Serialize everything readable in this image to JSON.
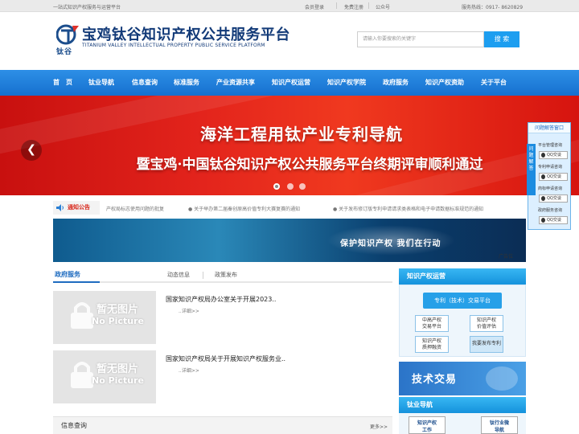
{
  "topbar": {
    "slogan": "一站式知识产权服务与运营平台",
    "login": "会员登录",
    "register": "免费注册",
    "wechat": "公众号",
    "hotline": "服务热线：0917- 8620829"
  },
  "header": {
    "logo_mark": "钛谷",
    "title": "宝鸡钛谷知识产权公共服务平台",
    "subtitle": "TITANIUM VALLEY INTELLECTUAL PROPERTY PUBLIC SERVICE PLATFORM",
    "search_placeholder": "请输入你要搜索的关键字",
    "search_button": "搜 索"
  },
  "nav": [
    "首　页",
    "钛业导航",
    "信息查询",
    "标准服务",
    "产业资源共享",
    "知识产权运营",
    "知识产权学院",
    "政府服务",
    "知识产权资助",
    "关于平台"
  ],
  "banner": {
    "line1": "海洋工程用钛产业专利导航",
    "line2": "暨宝鸡·中国钛谷知识产权公共服务平台终期评审顺利通过",
    "slide_total": 3,
    "slide_active": 1
  },
  "notice": {
    "label": "通知公告",
    "items": [
      "产权局标志使用问题的批复",
      "● 关于举办第二届秦创原高价值专利大赛复赛的通知",
      "● 关于发布修订版专利申请请求类表格和电子申请数据标准规范的通知"
    ]
  },
  "ad": {
    "text": "保护知识产权   我们在行动",
    "tag": "广告位"
  },
  "tabs": {
    "active": "政府服务",
    "items": [
      "动态信息",
      "政策发布"
    ]
  },
  "news": [
    {
      "title": "国家知识产权局办公室关于开展2023..",
      "more": "..详细>>",
      "placeholder_cn": "暂无图片",
      "placeholder_en": "No Picture"
    },
    {
      "title": "国家知识产权局关于开展知识产权服务业..",
      "more": "..详细>>",
      "placeholder_cn": "暂无图片",
      "placeholder_en": "No Picture"
    }
  ],
  "info": {
    "title": "信息查询",
    "more": "更多>>"
  },
  "sidebar": {
    "ip_title": "知识产权运营",
    "ip_main": "专利（技术）交易平台",
    "ip_buttons": [
      {
        "l1": "中高产权",
        "l2": "交易平台"
      },
      {
        "l1": "知识产权",
        "l2": "价值评估"
      },
      {
        "l1": "知识产权",
        "l2": "质押融资"
      },
      {
        "l1": "我要发布专利",
        "l2": ""
      }
    ],
    "trade_text": "技术交易",
    "nav_title": "钛业导航",
    "nav_cards": [
      {
        "l1": "知识产权",
        "l2": "工作"
      },
      {
        "l1": "钛行业微",
        "l2": "导航"
      }
    ]
  },
  "float_panel": {
    "header": "问题解答窗口",
    "tab": "问题解答",
    "items": [
      {
        "label": "平台管理咨询",
        "qq": "QQ交谈"
      },
      {
        "label": "专利申请咨询",
        "qq": "QQ交谈"
      },
      {
        "label": "商标申请咨询",
        "qq": "QQ交谈"
      },
      {
        "label": "政府服务咨询",
        "qq": "QQ交谈"
      }
    ]
  },
  "colors": {
    "primary": "#1d9ef0",
    "nav": "#1670cf",
    "banner": "#e3241c",
    "notice": "#d8261a"
  }
}
